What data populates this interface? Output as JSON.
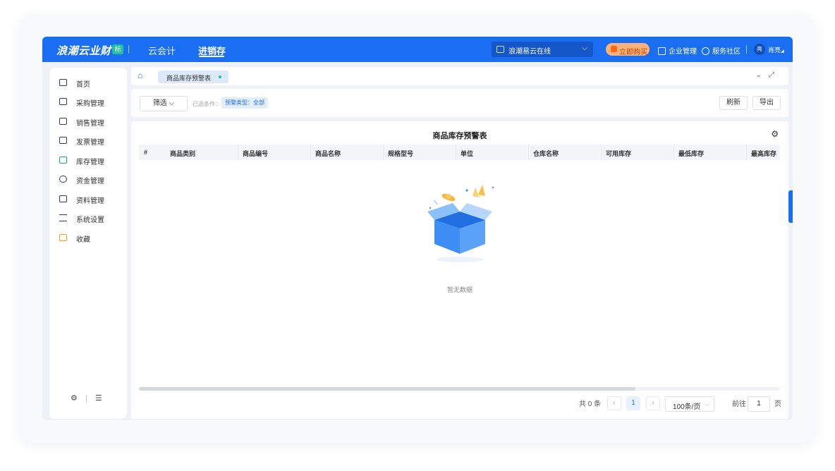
{
  "header": {
    "brand": "浪潮云业财",
    "brand_badge": "标",
    "tabs": [
      {
        "label": "云会计"
      },
      {
        "label": "进销存"
      }
    ],
    "org_select": "浪潮易云在线",
    "buy_label": "立即购买",
    "enterprise_label": "企业管理",
    "community_label": "服务社区",
    "avatar_text": "亮",
    "user_name": "肖亮"
  },
  "sidebar": {
    "items": [
      {
        "label": "首页"
      },
      {
        "label": "采购管理"
      },
      {
        "label": "销售管理"
      },
      {
        "label": "发票管理"
      },
      {
        "label": "库存管理"
      },
      {
        "label": "资金管理"
      },
      {
        "label": "资料管理"
      },
      {
        "label": "系统设置"
      },
      {
        "label": "收藏"
      }
    ]
  },
  "breadcrumb": {
    "tab": "商品库存预警表"
  },
  "filter": {
    "button": "筛选",
    "cond_label": "已选条件：",
    "cond_tag": "预警类型：全部",
    "refresh": "刷新",
    "export": "导出"
  },
  "table": {
    "title": "商品库存预警表",
    "columns": [
      "#",
      "商品类别",
      "商品编号",
      "商品名称",
      "规格型号",
      "单位",
      "仓库名称",
      "可用库存",
      "最低库存",
      "最高库存"
    ],
    "empty_text": "暂无数据"
  },
  "pagination": {
    "total_text": "共 0 条",
    "current_page": "1",
    "page_size": "100条/页",
    "goto_label": "前往",
    "goto_value": "1",
    "page_unit": "页"
  }
}
